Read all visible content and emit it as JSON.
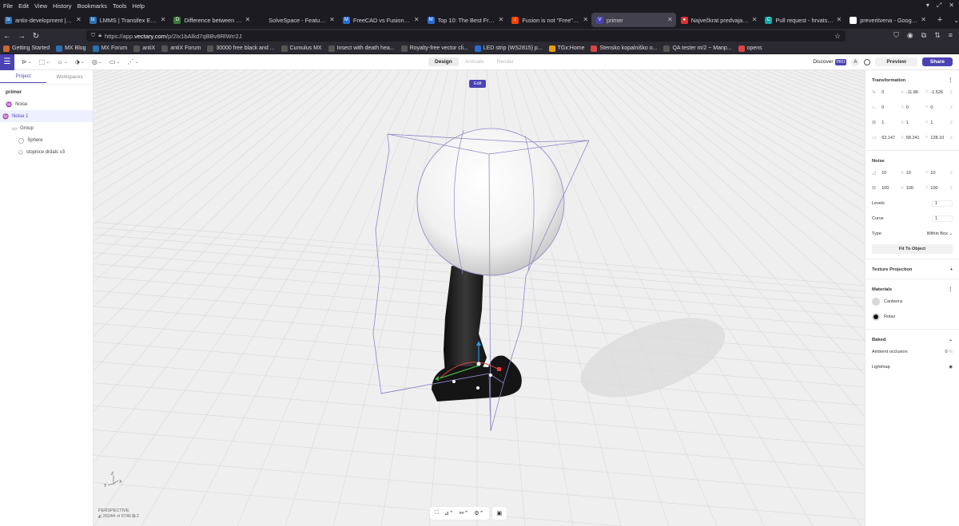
{
  "menu": [
    "File",
    "Edit",
    "View",
    "History",
    "Bookmarks",
    "Tools",
    "Help"
  ],
  "tabs": [
    {
      "label": "antix-development | Tra",
      "icon": "tx",
      "color": "#2d6fb3"
    },
    {
      "label": "LMMS | Transifex Editor",
      "icon": "tx",
      "color": "#2d6fb3"
    },
    {
      "label": "Difference between CAD",
      "icon": "D",
      "color": "#3a7a3a"
    },
    {
      "label": "SolveSpace - Features",
      "icon": "",
      "color": "#1c1b22"
    },
    {
      "label": "FreeCAD vs Fusion 360: T",
      "icon": "M",
      "color": "#2a6cd4"
    },
    {
      "label": "Top 10: The Best Free CA",
      "icon": "M",
      "color": "#2a6cd4"
    },
    {
      "label": "Fusion is not \"Free\" : r/Fu",
      "icon": "r",
      "color": "#ff4500"
    },
    {
      "label": "primer",
      "icon": "V",
      "color": "#4b43b4"
    },
    {
      "label": "Največkrat predvajane ski",
      "icon": "●",
      "color": "#d33"
    },
    {
      "label": "Pull request - hrvatski pri",
      "icon": "C",
      "color": "#1aa"
    },
    {
      "label": "preveritvena - Google Se",
      "icon": "G",
      "color": "#fff"
    }
  ],
  "url": {
    "prefix": "https://app.",
    "domain": "vectary.com",
    "path": "/p/2Ix1bAlkd7qBBv8RlWrr2J"
  },
  "bookmarks": [
    "Getting Started",
    "MX Blog",
    "MX Forum",
    "antiX",
    "antiX Forum",
    "30000 free black and ...",
    "Cumulus MX",
    "Insect with death hea...",
    "Royalty-free vector cli...",
    "LED strip (WS2815) p...",
    "TGx:Home",
    "Stensko kopalniško o...",
    "QA tester m/2 ~ Manp...",
    "opens"
  ],
  "toolbar": {
    "modes": [
      "Design",
      "Animate",
      "Render"
    ],
    "discover": "Discover",
    "pro": "PRO",
    "avatar": "A",
    "preview": "Preview",
    "share": "Share"
  },
  "left": {
    "tabs": [
      "Project",
      "Workspaces"
    ],
    "project": "primer",
    "items": [
      {
        "label": "Noise",
        "icon": "♒",
        "indent": 0
      },
      {
        "label": "Noise 1",
        "icon": "♒",
        "indent": 0,
        "selected": true
      },
      {
        "label": "Group",
        "icon": "▭",
        "indent": 1
      },
      {
        "label": "Sphere",
        "icon": "◯",
        "indent": 2
      },
      {
        "label": "stopnice drdals v3",
        "icon": "⬡",
        "indent": 2
      }
    ]
  },
  "viewport": {
    "edit": "Edit",
    "view_label": "PERSPECTIVE",
    "stats": "◭ 26244  ⊲ 6746  ⧉ 2",
    "axis": {
      "z": "Z",
      "x": "X",
      "y": "Y"
    }
  },
  "right": {
    "transformation": "Transformation",
    "pos": [
      "0",
      "-11.86·",
      "-1.526"
    ],
    "rot": [
      "0",
      "0",
      "0"
    ],
    "scale": [
      "1",
      "1",
      "1"
    ],
    "size": [
      "63.147",
      "58.241",
      "128.10"
    ],
    "noise": "Noise",
    "n1": [
      "10",
      "10",
      "10"
    ],
    "n2": [
      "100",
      "100",
      "100"
    ],
    "levels_label": "Levels",
    "levels": "1",
    "curve_label": "Curve",
    "curve": "1",
    "type_label": "Type",
    "type": "Within Box",
    "fit": "Fit To Object",
    "texture": "Texture Projection",
    "materials": "Materials",
    "mats": [
      {
        "name": "Canberra",
        "color": "#d8d8d8"
      },
      {
        "name": "Rotax",
        "color": "#111111"
      }
    ],
    "baked": "Baked",
    "ao_label": "Ambient occlusion",
    "ao": "0",
    "ao_unit": "%",
    "lightmap": "Lightmap"
  }
}
